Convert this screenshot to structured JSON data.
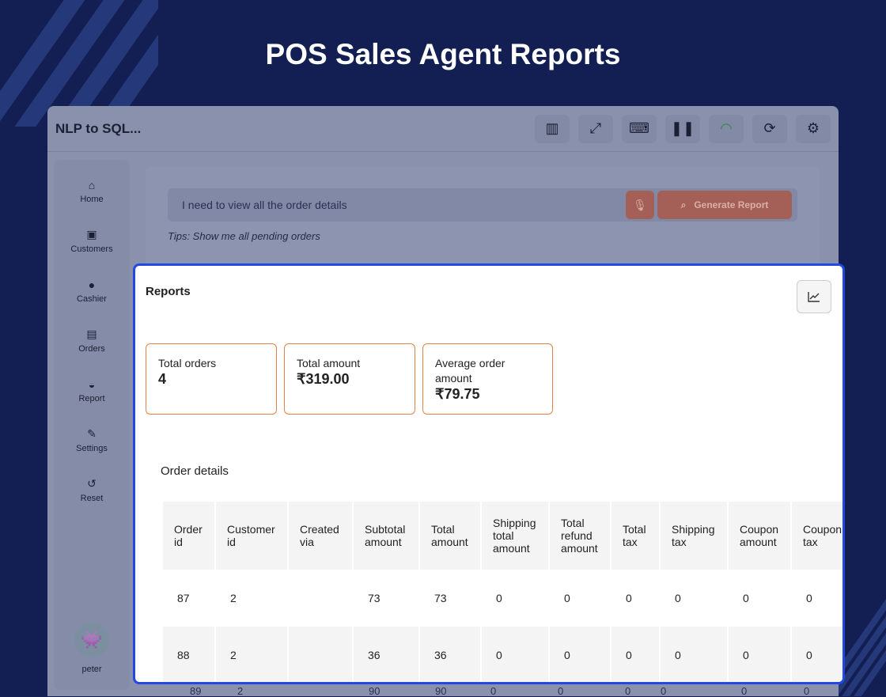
{
  "banner_title": "POS Sales Agent Reports",
  "app": {
    "title": "NLP to SQL...",
    "toolbar": [
      "chart-report-icon",
      "expand-icon",
      "keyboard-icon",
      "pause-icon",
      "wifi-icon",
      "refresh-icon",
      "settings-icon"
    ]
  },
  "sidebar": {
    "items": [
      {
        "label": "Home",
        "icon": "⌂"
      },
      {
        "label": "Customers",
        "icon": "▣"
      },
      {
        "label": "Cashier",
        "icon": "●"
      },
      {
        "label": "Orders",
        "icon": "▤"
      },
      {
        "label": "Report",
        "icon": "◒"
      },
      {
        "label": "Settings",
        "icon": "✎"
      },
      {
        "label": "Reset",
        "icon": "↺"
      }
    ],
    "user": "peter"
  },
  "query": {
    "value": "I need to view all the order details",
    "generate_label": "Generate Report",
    "tips": "Tips: Show me all pending orders"
  },
  "reports": {
    "title": "Reports",
    "stats": [
      {
        "label": "Total orders",
        "value": "4"
      },
      {
        "label": "Total amount",
        "value": "₹319.00"
      },
      {
        "label": "Average order amount",
        "value": "₹79.75"
      }
    ],
    "table_title": "Order details",
    "columns": [
      "Order id",
      "Customer id",
      "Created via",
      "Subtotal amount",
      "Total amount",
      "Shipping total amount",
      "Total refund amount",
      "Total tax",
      "Shipping tax",
      "Coupon amount",
      "Coupon tax"
    ],
    "rows": [
      [
        "87",
        "2",
        "",
        "73",
        "73",
        "0",
        "0",
        "0",
        "0",
        "0",
        "0"
      ],
      [
        "88",
        "2",
        "",
        "36",
        "36",
        "0",
        "0",
        "0",
        "0",
        "0",
        "0"
      ],
      [
        "89",
        "2",
        "",
        "90",
        "90",
        "0",
        "0",
        "0",
        "0",
        "0",
        "0"
      ]
    ]
  },
  "colors": {
    "accent": "#e8813f",
    "highlight": "#2348e6",
    "background": "#131f52"
  }
}
